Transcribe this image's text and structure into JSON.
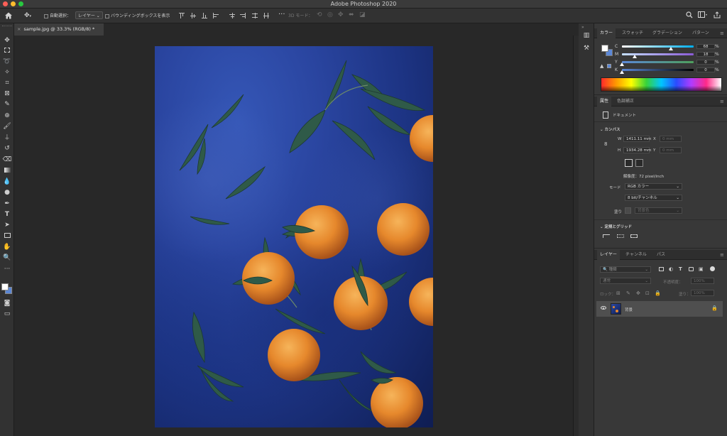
{
  "app_title": "Adobe Photoshop 2020",
  "options_bar": {
    "auto_select_label": "自動選択：",
    "layer_select_value": "レイヤー",
    "bbox_label": "バウンディングボックスを表示",
    "mode_3d_label": "3D モード："
  },
  "document": {
    "tab_label": "sample.jpg @ 33.3% (RGB/8) *"
  },
  "color_panel": {
    "tabs": [
      "カラー",
      "スウォッチ",
      "グラデーション",
      "パターン"
    ],
    "channels": [
      {
        "label": "C",
        "value": "68",
        "percent": "%"
      },
      {
        "label": "M",
        "value": "18",
        "percent": "%"
      },
      {
        "label": "Y",
        "value": "0",
        "percent": "%"
      },
      {
        "label": "K",
        "value": "0",
        "percent": "%"
      }
    ],
    "foreground_color": "#ffffff",
    "background_color": "#5b87d6"
  },
  "properties_panel": {
    "tabs": [
      "属性",
      "色調補正"
    ],
    "doc_label": "ドキュメント",
    "canvas_section": "カンバス",
    "w_label": "W",
    "w_value": "1411.11 mm",
    "h_label": "H",
    "h_value": "1934.28 mm",
    "x_label": "X",
    "x_value": "0 mm",
    "y_label": "Y",
    "y_value": "0 mm",
    "resolution": "解像度：72 pixel/inch",
    "mode_label": "モード",
    "mode_value": "RGB カラー",
    "bit_value": "8 bit/チャンネル",
    "fill_label": "塗り",
    "fill_value": "背景色",
    "guides_section": "定規とグリッド"
  },
  "layers_panel": {
    "tabs": [
      "レイヤー",
      "チャンネル",
      "パス"
    ],
    "filter_label": "種類",
    "blend_mode": "通常",
    "opacity_label": "不透明度：",
    "opacity_value": "100%",
    "lock_label": "ロック：",
    "fill_label": "塗り：",
    "fill_value": "100%",
    "layers": [
      {
        "name": "背景"
      }
    ]
  }
}
